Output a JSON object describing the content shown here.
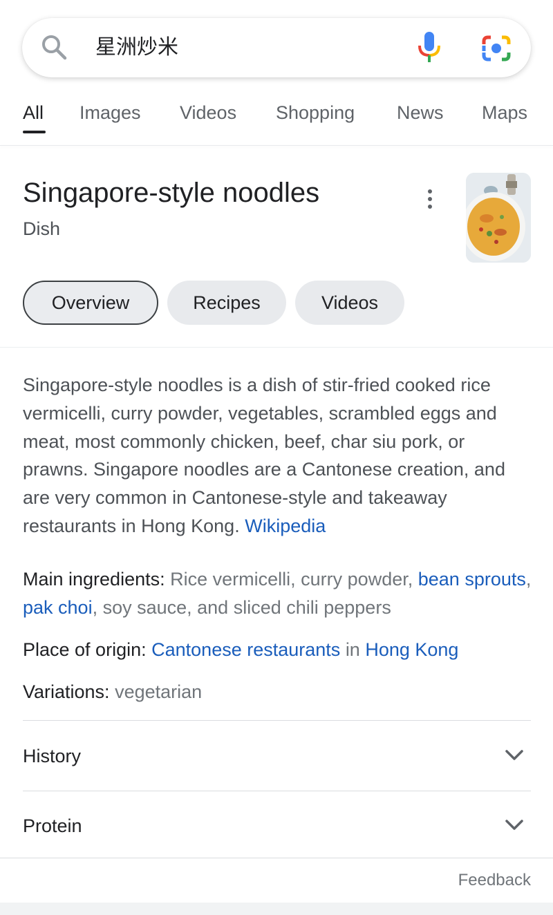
{
  "search": {
    "query": "星洲炒米",
    "search_icon": "search-icon",
    "voice_icon": "microphone-icon",
    "lens_icon": "google-lens-icon"
  },
  "tabs": [
    {
      "label": "All",
      "active": true
    },
    {
      "label": "Images"
    },
    {
      "label": "Videos"
    },
    {
      "label": "Shopping"
    },
    {
      "label": "News"
    },
    {
      "label": "Maps"
    }
  ],
  "knowledge_panel": {
    "title": "Singapore-style noodles",
    "subtitle": "Dish",
    "chips": [
      {
        "label": "Overview",
        "selected": true
      },
      {
        "label": "Recipes"
      },
      {
        "label": "Videos"
      }
    ],
    "description": "Singapore-style noodles is a dish of stir-fried cooked rice vermicelli, curry powder, vegetables, scrambled eggs and meat, most commonly chicken, beef, char siu pork, or prawns. Singapore noodles are a Cantonese creation, and are very common in Cantonese-style and takeaway restaurants in Hong Kong.",
    "source_link": "Wikipedia",
    "facts": {
      "ingredients": {
        "label": "Main ingredients:",
        "text_1": "Rice vermicelli, curry powder,",
        "link_1": "bean sprouts",
        "sep_1": ",",
        "link_2": "pak choi",
        "text_2": ", soy sauce, and sliced chili peppers"
      },
      "origin": {
        "label": "Place of origin:",
        "link_1": "Cantonese restaurants",
        "text_1": "in",
        "link_2": "Hong Kong"
      },
      "variations": {
        "label": "Variations:",
        "value": "vegetarian"
      }
    },
    "expanders": [
      {
        "label": "History"
      },
      {
        "label": "Protein"
      }
    ],
    "feedback": "Feedback"
  },
  "colors": {
    "link": "#1a5dbb",
    "text_primary": "#202124",
    "text_secondary": "#4d5156",
    "chip_bg": "#e8eaed"
  }
}
